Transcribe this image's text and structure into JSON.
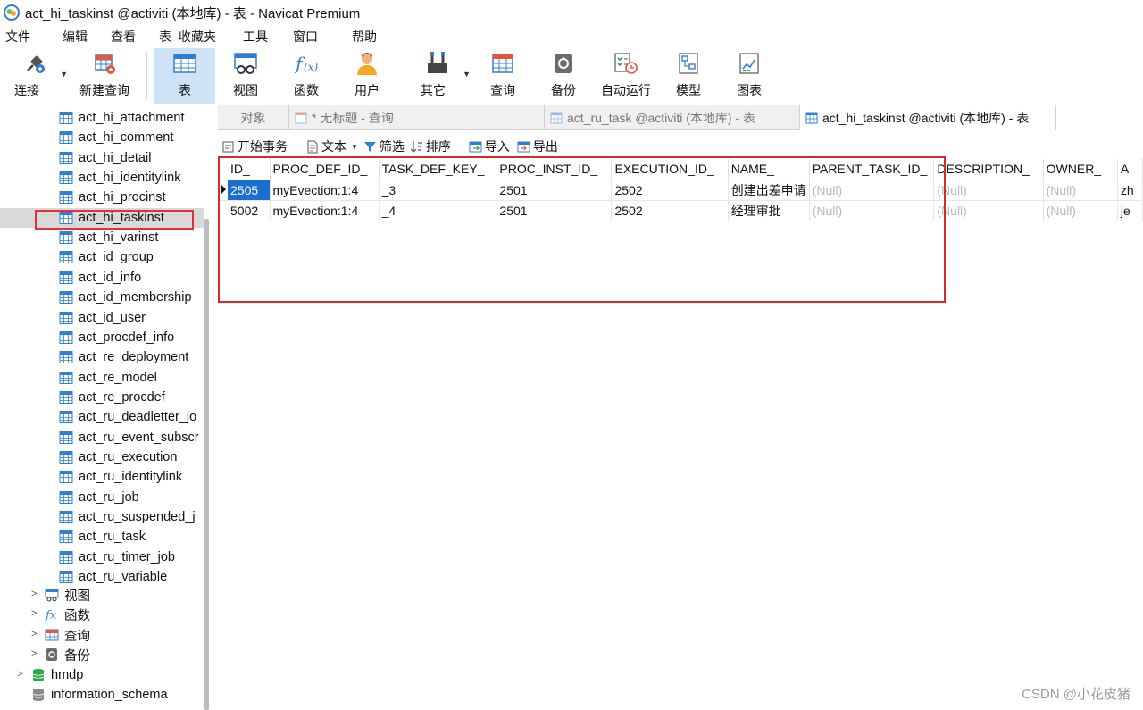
{
  "window": {
    "title": "act_hi_taskinst @activiti (本地库) - 表 - Navicat Premium"
  },
  "menu": [
    "文件",
    "编辑",
    "查看",
    "表",
    "收藏夹",
    "工具",
    "窗口",
    "帮助"
  ],
  "toolbar": {
    "connect": "连接",
    "new_query": "新建查询",
    "table": "表",
    "view": "视图",
    "function": "函数",
    "user": "用户",
    "other": "其它",
    "query": "查询",
    "backup": "备份",
    "automation": "自动运行",
    "model": "模型",
    "chart": "图表"
  },
  "sidebar": {
    "tables": [
      "act_hi_attachment",
      "act_hi_comment",
      "act_hi_detail",
      "act_hi_identitylink",
      "act_hi_procinst",
      "act_hi_taskinst",
      "act_hi_varinst",
      "act_id_group",
      "act_id_info",
      "act_id_membership",
      "act_id_user",
      "act_procdef_info",
      "act_re_deployment",
      "act_re_model",
      "act_re_procdef",
      "act_ru_deadletter_jo",
      "act_ru_event_subscr",
      "act_ru_execution",
      "act_ru_identitylink",
      "act_ru_job",
      "act_ru_suspended_j",
      "act_ru_task",
      "act_ru_timer_job",
      "act_ru_variable"
    ],
    "groups": [
      "视图",
      "函数",
      "查询",
      "备份"
    ],
    "databases": [
      "hmdp",
      "information_schema"
    ]
  },
  "tabs": {
    "objects": "对象",
    "untitled_query": "* 无标题 - 查询",
    "ru_task": "act_ru_task @activiti (本地库) - 表",
    "hi_taskinst": "act_hi_taskinst @activiti (本地库) - 表"
  },
  "subtoolbar": {
    "begin_tx": "开始事务",
    "text": "文本",
    "filter": "筛选",
    "sort": "排序",
    "import": "导入",
    "export": "导出"
  },
  "grid": {
    "columns": [
      "ID_",
      "PROC_DEF_ID_",
      "TASK_DEF_KEY_",
      "PROC_INST_ID_",
      "EXECUTION_ID_",
      "NAME_",
      "PARENT_TASK_ID_",
      "DESCRIPTION_",
      "OWNER_",
      "A"
    ],
    "rows": [
      [
        "2505",
        "myEvection:1:4",
        "_3",
        "2501",
        "2502",
        "创建出差申请",
        "(Null)",
        "(Null)",
        "(Null)",
        "zh"
      ],
      [
        "5002",
        "myEvection:1:4",
        "_4",
        "2501",
        "2502",
        "经理审批",
        "(Null)",
        "(Null)",
        "(Null)",
        "je"
      ]
    ]
  },
  "watermark": "CSDN @小花皮猪",
  "colors": {
    "selection": "#1a6dd1",
    "highlight_box": "#d42a2a",
    "active_tool": "#cfe3f7"
  }
}
